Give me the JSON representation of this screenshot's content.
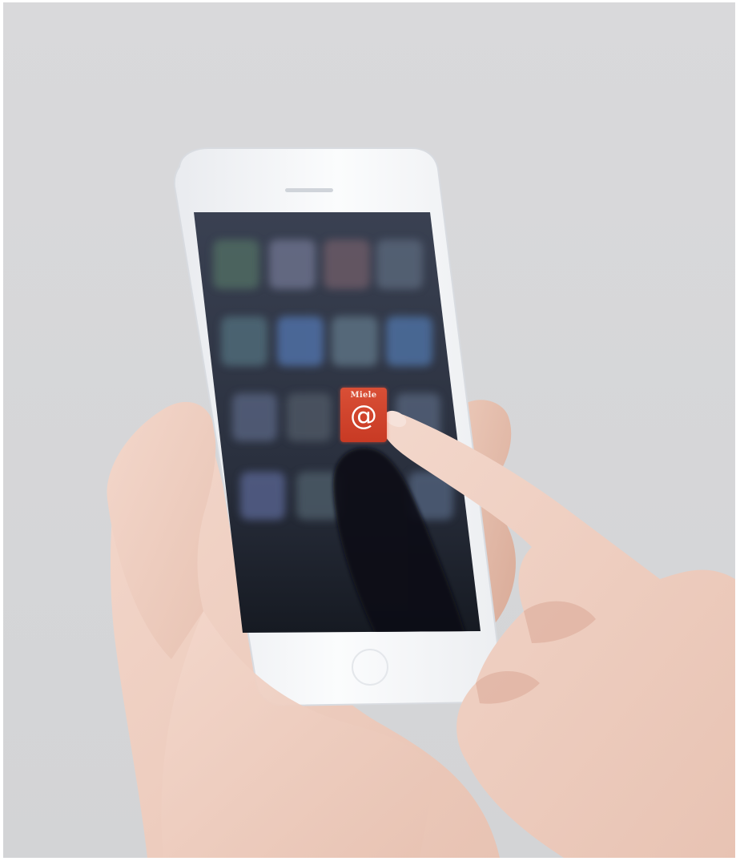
{
  "photo": {
    "background_color": "#d6d7d9",
    "phone_body_color": "#f7f8fa",
    "screen_color": "#2b3140"
  },
  "app_icon": {
    "wordmark": "Miele",
    "symbol": "@",
    "icon_name": "miele-at-app-icon",
    "color": "#cf4029"
  }
}
